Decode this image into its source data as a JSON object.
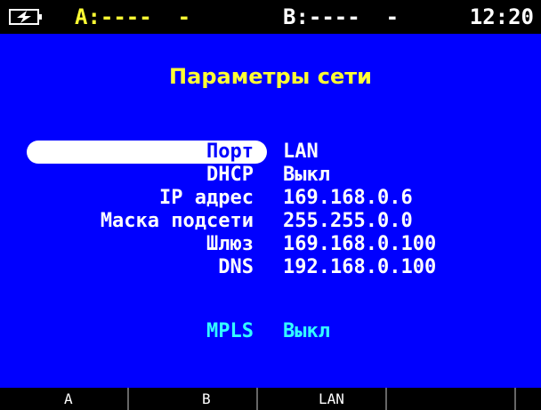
{
  "status_bar": {
    "battery_icon": "battery-charging-icon",
    "channel_a": "A:----  -",
    "channel_b": "B:----  -",
    "clock": "12:20"
  },
  "screen": {
    "title": "Параметры сети",
    "fields": [
      {
        "label": "Порт",
        "value": "LAN"
      },
      {
        "label": "DHCP",
        "value": "Выкл"
      },
      {
        "label": "IP адрес",
        "value": "169.168.0.6"
      },
      {
        "label": "Маска подсети",
        "value": "255.255.0.0"
      },
      {
        "label": "Шлюз",
        "value": "169.168.0.100"
      },
      {
        "label": "DNS",
        "value": "192.168.0.100"
      }
    ],
    "mpls": {
      "label": "MPLS",
      "value": "Выкл"
    }
  },
  "function_keys": [
    "A",
    "B",
    "LAN",
    "",
    ""
  ],
  "colors": {
    "background": "#0000ff",
    "title": "#ffff33",
    "mpls": "#33ffff",
    "bars": "#000000"
  }
}
